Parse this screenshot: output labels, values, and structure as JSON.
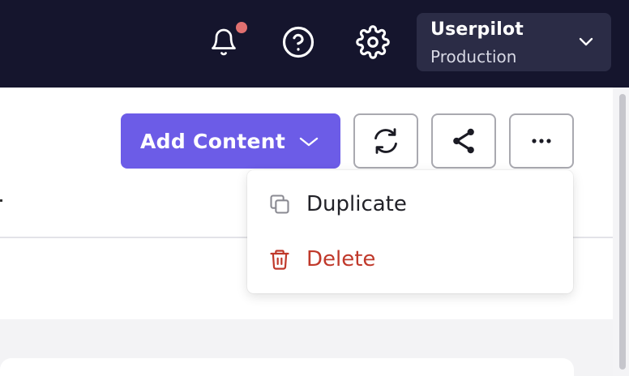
{
  "header": {
    "notifications_icon": "bell-icon",
    "help_icon": "help-circle-icon",
    "settings_icon": "gear-icon",
    "environment": {
      "name": "Userpilot",
      "label": "Production"
    }
  },
  "toolbar": {
    "add_content_label": "Add Content",
    "sync_icon": "sync-icon",
    "share_icon": "share-icon",
    "more_icon": "more-horizontal-icon"
  },
  "menu": {
    "items": [
      {
        "label": "Duplicate",
        "icon": "copy-icon"
      },
      {
        "label": "Delete",
        "icon": "trash-icon"
      }
    ]
  },
  "colors": {
    "topbar": "#15152d",
    "accent": "#6c5ce7",
    "danger": "#c0392b",
    "notification_dot": "#e07070"
  }
}
